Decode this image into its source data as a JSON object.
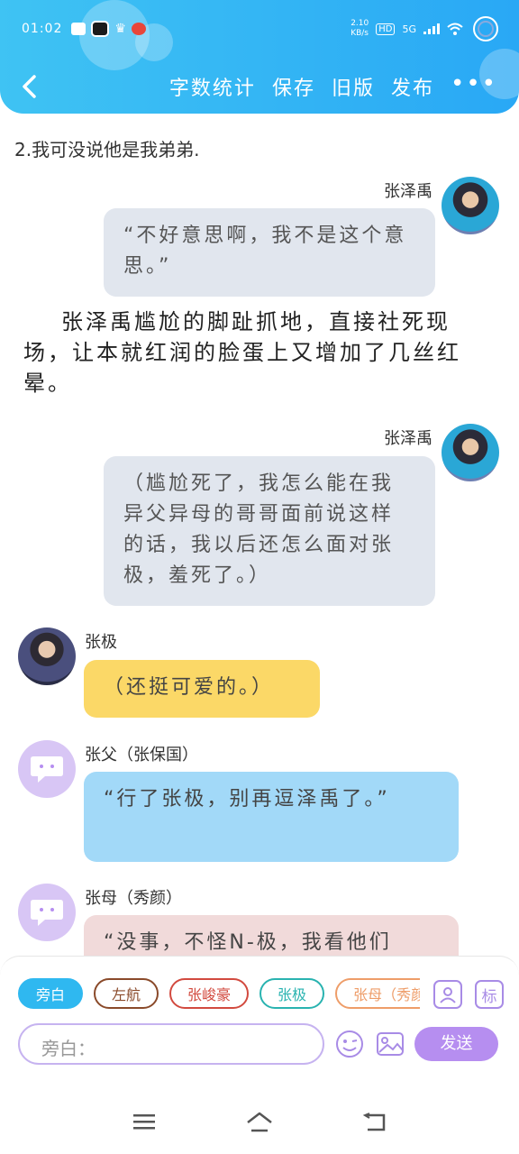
{
  "status": {
    "time": "01:02",
    "net_speed": "2.10",
    "net_unit": "KB/s",
    "hd": "HD",
    "net_type": "5G"
  },
  "nav": {
    "actions": [
      "字数统计",
      "保存",
      "旧版",
      "发布"
    ],
    "more": "•••"
  },
  "content": {
    "line1": "2.我可没说他是我弟弟.",
    "msg1": {
      "name": "张泽禹",
      "text": "“不好意思啊，我不是这个意思。”"
    },
    "narration": "张泽禹尴尬的脚趾抓地，直接社死现场，让本就红润的脸蛋上又增加了几丝红晕。",
    "msg2": {
      "name": "张泽禹",
      "text": "（尴尬死了，我怎么能在我异父异母的哥哥面前说这样的话，我以后还怎么面对张极，羞死了。）"
    },
    "msg3": {
      "name": "张极",
      "text": "（还挺可爱的。）"
    },
    "msg4": {
      "name": "张父（张保国）",
      "text": "“行了张极，别再逗泽禹了。”"
    },
    "msg5": {
      "name": "张母（秀颜）",
      "text": "“没事，不怪N-极，我看他们"
    }
  },
  "composer": {
    "chips": [
      "旁白",
      "左航",
      "张峻豪",
      "张极",
      "张母（秀颜）"
    ],
    "mark_label": "标",
    "placeholder": "旁白：",
    "send_label": "发送"
  },
  "colors": {
    "header": "#29a8f5",
    "accent_purple": "#b68ef0",
    "bubble_gray": "#e1e6ee",
    "bubble_yellow": "#fbd867",
    "bubble_blue": "#a2d9f8",
    "bubble_pink": "#f1dada"
  }
}
